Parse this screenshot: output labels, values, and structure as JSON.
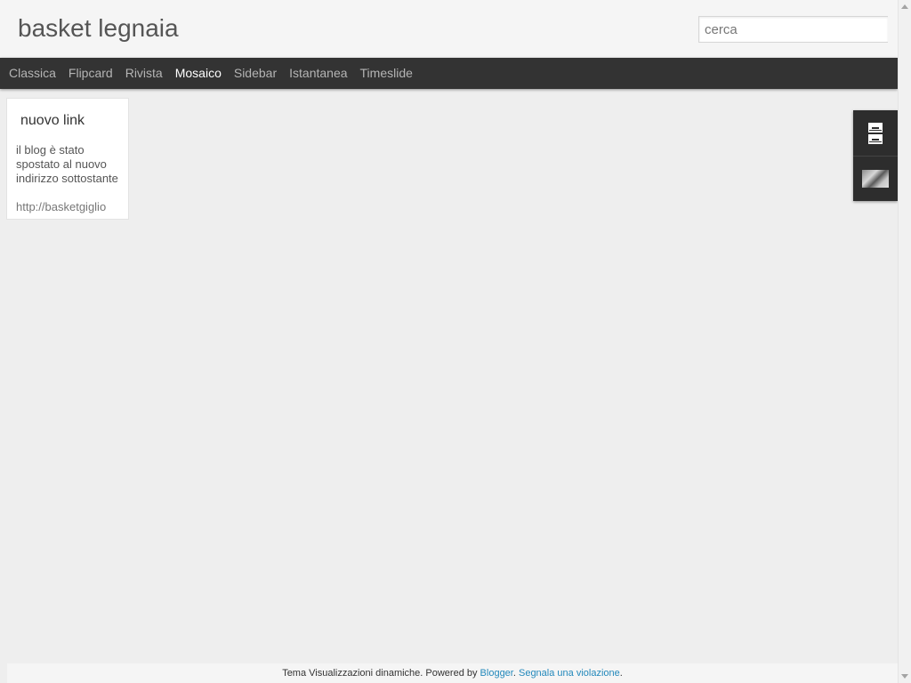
{
  "header": {
    "title": "basket legnaia",
    "search_placeholder": "cerca"
  },
  "nav": {
    "items": [
      {
        "label": "Classica",
        "active": false
      },
      {
        "label": "Flipcard",
        "active": false
      },
      {
        "label": "Rivista",
        "active": false
      },
      {
        "label": "Mosaico",
        "active": true
      },
      {
        "label": "Sidebar",
        "active": false
      },
      {
        "label": "Istantanea",
        "active": false
      },
      {
        "label": "Timeslide",
        "active": false
      }
    ]
  },
  "widget": {
    "title": "nuovo link",
    "body": "il blog è stato spostato al nuovo indirizzo sottostante",
    "link": "http://basketgiglio"
  },
  "side_gadgets": {
    "icons": [
      "archive-icon",
      "profile-photo"
    ]
  },
  "footer": {
    "text": "Tema Visualizzazioni dinamiche. Powered by",
    "blogger_link": "Blogger",
    "separator": ".",
    "report_link": "Segnala una violazione",
    "end": "."
  },
  "colors": {
    "nav_bg": "#333333",
    "nav_active": "#ffffff",
    "nav_text": "#b4b4b4",
    "link": "#2288bb",
    "background": "#eeeeee"
  }
}
